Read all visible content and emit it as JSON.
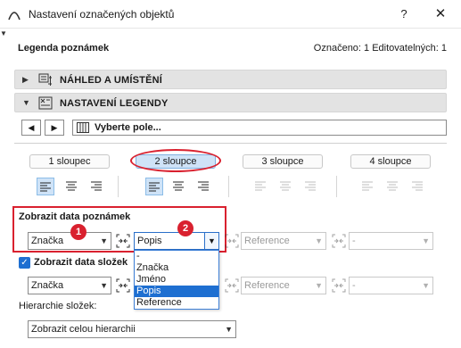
{
  "window": {
    "title": "Nastavení označených objektů",
    "help_glyph": "?",
    "close_glyph": "✕"
  },
  "header": {
    "panel_title": "Legenda poznámek",
    "status": "Označeno: 1 Editovatelných: 1"
  },
  "sections": [
    {
      "label": "NÁHLED A UMÍSTĚNÍ",
      "expanded": false
    },
    {
      "label": "NASTAVENÍ LEGENDY",
      "expanded": true
    }
  ],
  "field_nav": {
    "prev_glyph": "◀",
    "next_glyph": "▶",
    "field_placeholder": "Vyberte pole..."
  },
  "column_tabs": [
    {
      "label": "1 sloupec",
      "active": false
    },
    {
      "label": "2 sloupce",
      "active": true
    },
    {
      "label": "3 sloupce",
      "active": false
    },
    {
      "label": "4 sloupce",
      "active": false
    }
  ],
  "note_data": {
    "title": "Zobrazit data poznámek",
    "badge_1": "1",
    "badge_2": "2",
    "field1": "Značka",
    "field2": "Popis",
    "field3": "Reference",
    "field4": "-"
  },
  "element_data": {
    "checkbox_checked": true,
    "label": "Zobrazit data složek",
    "field1": "Značka",
    "field3": "Reference",
    "field4": "-"
  },
  "hierarchy": {
    "label": "Hierarchie složek:",
    "value": "Zobrazit celou hierarchii"
  },
  "dropdown_list": {
    "items": [
      "-",
      "Značka",
      "Jméno",
      "Popis",
      "Reference"
    ],
    "selected": "Popis"
  },
  "colors": {
    "accent": "#1e6fd1",
    "highlight_red": "#d9212f",
    "selected_tab": "#cfe3f7"
  }
}
